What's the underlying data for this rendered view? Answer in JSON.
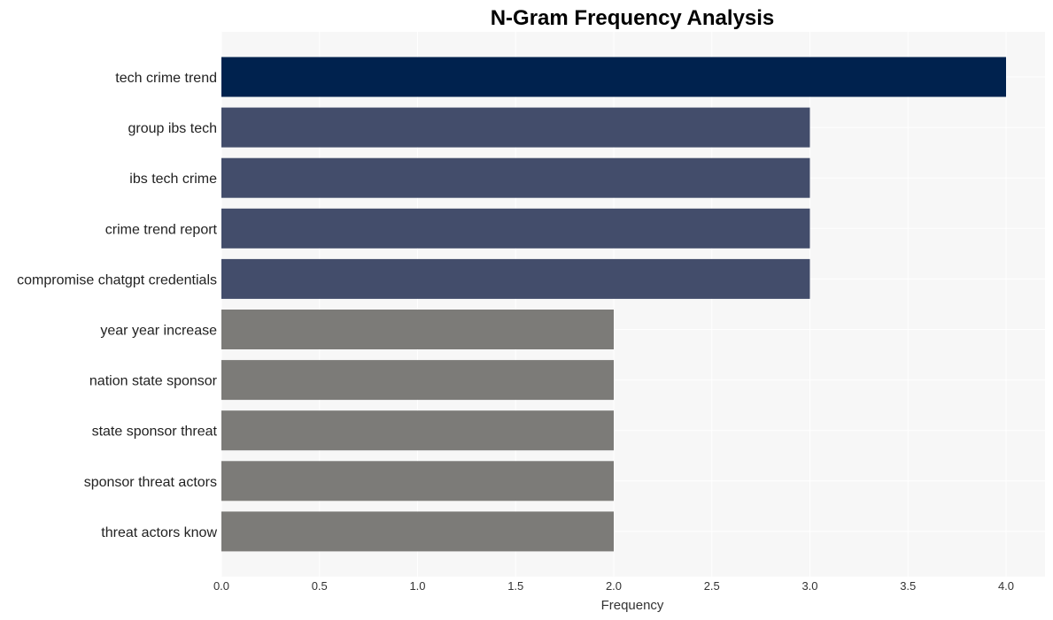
{
  "chart_data": {
    "type": "bar",
    "orientation": "horizontal",
    "title": "N-Gram Frequency Analysis",
    "xlabel": "Frequency",
    "ylabel": "",
    "xlim": [
      0,
      4.2
    ],
    "xticks": [
      "0.0",
      "0.5",
      "1.0",
      "1.5",
      "2.0",
      "2.5",
      "3.0",
      "3.5",
      "4.0"
    ],
    "grid": true,
    "legend": "none",
    "categories": [
      "tech crime trend",
      "group ibs tech",
      "ibs tech crime",
      "crime trend report",
      "compromise chatgpt credentials",
      "year year increase",
      "nation state sponsor",
      "state sponsor threat",
      "sponsor threat actors",
      "threat actors know"
    ],
    "values": [
      4,
      3,
      3,
      3,
      3,
      2,
      2,
      2,
      2,
      2
    ],
    "colors": {
      "4": "#00224e",
      "3": "#434d6b",
      "2": "#7c7b78",
      "plot_background": "#f7f7f7",
      "grid": "#ffffff"
    }
  }
}
